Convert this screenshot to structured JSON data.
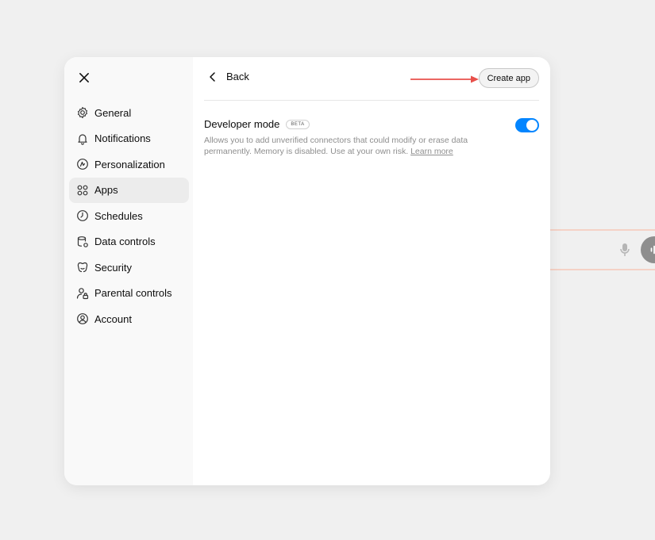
{
  "sidebar": {
    "items": [
      {
        "label": "General",
        "icon": "gear-icon"
      },
      {
        "label": "Notifications",
        "icon": "bell-icon"
      },
      {
        "label": "Personalization",
        "icon": "personalization-icon"
      },
      {
        "label": "Apps",
        "icon": "apps-grid-icon",
        "active": true
      },
      {
        "label": "Schedules",
        "icon": "clock-icon"
      },
      {
        "label": "Data controls",
        "icon": "database-gear-icon"
      },
      {
        "label": "Security",
        "icon": "shield-icon"
      },
      {
        "label": "Parental controls",
        "icon": "parental-icon"
      },
      {
        "label": "Account",
        "icon": "account-circle-icon"
      }
    ]
  },
  "header": {
    "back_label": "Back",
    "create_label": "Create app"
  },
  "developer": {
    "title": "Developer mode",
    "badge": "BETA",
    "description": "Allows you to add unverified connectors that could modify or erase data permanently. Memory is disabled. Use at your own risk.",
    "learn_more": "Learn more",
    "enabled": true
  },
  "colors": {
    "accent": "#0285ff",
    "arrow": "#e8504b"
  }
}
